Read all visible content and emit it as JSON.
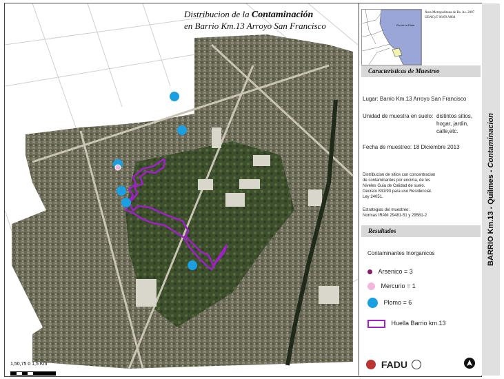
{
  "map": {
    "title_prefix": "Distribucion de la",
    "title_bold": "Contaminación",
    "title_line2": "en Barrio Km.13  Arroyo San Francisco",
    "scale_label": "1,50,75  0        1,5 Km"
  },
  "locator": {
    "river_label": "Rio de la Plata",
    "credit_line1": "Área Metropolitana de Bs. As. 2007",
    "credit_line2": "UBACyT 06/09   A804"
  },
  "sections": {
    "caracteristicas": "Caracteristicas de Muestreo",
    "resultados": "Resultados"
  },
  "muestreo": {
    "lugar": "Lugar:  Barrio Km.13  Arroyo San Francisco",
    "unidad_label": "Unidad de muestra en suelo:",
    "unidad_1": "distintos sitios,",
    "unidad_2": "hogar,  jardin,",
    "unidad_3": "calle,etc.",
    "fecha": "Fecha de muestreo:  18 Diciembre 2013",
    "dist_1": "Distribucion de sitios con concentracion",
    "dist_2": "de contaminantes por encima, de los",
    "dist_3": "Niveles Guia de Calidad de suelo.",
    "dist_4": "Decreto 831/93 para uso Residencial.",
    "dist_5": "Ley 24051.",
    "estrategias_1": "Estrategias del muestreo:",
    "estrategias_2": "Normas IRAM  29481-51 y 29581-2"
  },
  "legend": {
    "heading": "Contaminantes Inorganicos",
    "items": [
      {
        "label": "Arsenico = 3",
        "color": "#8b1a6b"
      },
      {
        "label": "Mercurio = 1",
        "color": "#f3b6dc"
      },
      {
        "label": "Plomo = 6",
        "color": "#1a9fe0"
      },
      {
        "label": "Huella Barrio km.13",
        "color": "#a020c8"
      }
    ]
  },
  "logos": {
    "fadu": "FADU"
  },
  "strip": {
    "text_bold": "BARRIO Km.13 - Quilmes -",
    "text_italic": "Contaminacion"
  },
  "map_points": [
    {
      "type": "plomo"
    },
    {
      "type": "plomo"
    },
    {
      "type": "plomo"
    },
    {
      "type": "plomo"
    },
    {
      "type": "plomo"
    },
    {
      "type": "plomo"
    },
    {
      "type": "mercurio"
    }
  ]
}
